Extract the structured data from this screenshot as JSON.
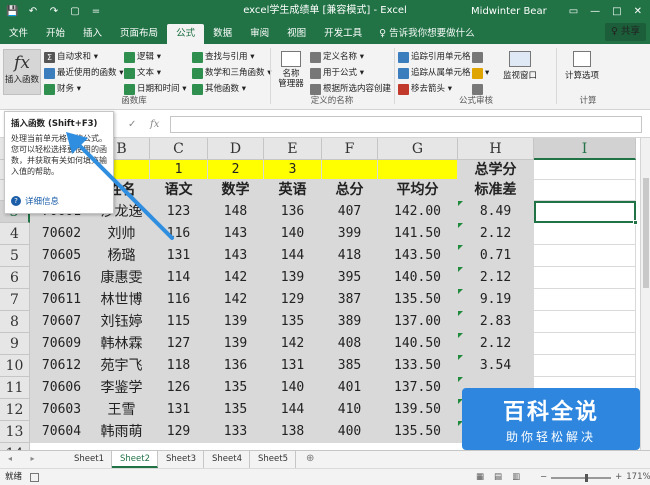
{
  "window": {
    "title": "excel学生成绩单 [兼容模式] - Excel",
    "user": "Midwinter Bear",
    "controls": [
      "▭",
      "—",
      "□",
      "✕"
    ]
  },
  "qat": [
    "💾",
    "↶",
    "↷",
    "▢",
    "="
  ],
  "tabs": [
    {
      "label": "文件",
      "active": false
    },
    {
      "label": "开始",
      "active": false
    },
    {
      "label": "插入",
      "active": false
    },
    {
      "label": "页面布局",
      "active": false
    },
    {
      "label": "公式",
      "active": true
    },
    {
      "label": "数据",
      "active": false
    },
    {
      "label": "审阅",
      "active": false
    },
    {
      "label": "视图",
      "active": false
    },
    {
      "label": "开发工具",
      "active": false
    }
  ],
  "tellme": "♀ 告诉我你想要做什么",
  "share": "♀ 共享",
  "ribbon": {
    "insert_function": {
      "glyph": "fx",
      "label": "插入函数"
    },
    "library": {
      "col1": [
        "自动求和 ▾",
        "最近使用的函数 ▾",
        "财务 ▾"
      ],
      "col2": [
        "逻辑 ▾",
        "文本 ▾",
        "日期和时间 ▾"
      ],
      "col3": [
        "查找与引用 ▾",
        "数学和三角函数 ▾",
        "其他函数 ▾"
      ],
      "group_label": "函数库"
    },
    "defined_names": {
      "name_manager": "名称\n管理器",
      "items": [
        "定义名称 ▾",
        "用于公式 ▾",
        "根据所选内容创建"
      ],
      "group_label": "定义的名称"
    },
    "auditing": {
      "col1": [
        "追踪引用单元格",
        "追踪从属单元格",
        "移去箭头 ▾"
      ],
      "col2": [
        "",
        "▾",
        ""
      ],
      "watch": "监视窗口",
      "group_label": "公式审核"
    },
    "calc": {
      "options": "计算选项",
      "group_label": "计算"
    }
  },
  "tooltip": {
    "title": "插入函数 (Shift+F3)",
    "desc": "处理当前单元格中的公式。您可以轻松选择要使用的函数，并获取有关如何填充输入值的帮助。",
    "more": "详细信息"
  },
  "formula_bar": {
    "controls": [
      "▾",
      "✕",
      "✓",
      "fx"
    ],
    "value": ""
  },
  "columns": [
    {
      "label": "A",
      "w": 0
    },
    {
      "label": "B",
      "w": 0
    },
    {
      "label": "C",
      "w": 0
    },
    {
      "label": "D",
      "w": 0
    },
    {
      "label": "E",
      "w": 0
    },
    {
      "label": "F",
      "w": 0
    },
    {
      "label": "G",
      "w": 0
    },
    {
      "label": "H",
      "w": 0
    },
    {
      "label": "I",
      "w": 0
    }
  ],
  "rows": [
    "1",
    "2",
    "3",
    "4",
    "5",
    "6",
    "7",
    "8",
    "9",
    "10",
    "11",
    "12",
    "13",
    "14"
  ],
  "selected_col": "I",
  "selected_row": "3",
  "header_row1": {
    "C": "1",
    "D": "2",
    "E": "3",
    "H": "总学分"
  },
  "header_row2": [
    "姓名",
    "语文",
    "数学",
    "英语",
    "总分",
    "平均分",
    "标准差"
  ],
  "students": [
    {
      "id": "70601",
      "name": "沙龙逸",
      "chinese": "123",
      "math": "148",
      "english": "136",
      "total": "407",
      "avg": "142.00",
      "sd": "8.49"
    },
    {
      "id": "70602",
      "name": "刘帅",
      "chinese": "116",
      "math": "143",
      "english": "140",
      "total": "399",
      "avg": "141.50",
      "sd": "2.12"
    },
    {
      "id": "70605",
      "name": "杨璐",
      "chinese": "131",
      "math": "143",
      "english": "144",
      "total": "418",
      "avg": "143.50",
      "sd": "0.71"
    },
    {
      "id": "70616",
      "name": "康惠雯",
      "chinese": "114",
      "math": "142",
      "english": "139",
      "total": "395",
      "avg": "140.50",
      "sd": "2.12"
    },
    {
      "id": "70611",
      "name": "林世博",
      "chinese": "116",
      "math": "142",
      "english": "129",
      "total": "387",
      "avg": "135.50",
      "sd": "9.19"
    },
    {
      "id": "70607",
      "name": "刘钰婷",
      "chinese": "115",
      "math": "139",
      "english": "135",
      "total": "389",
      "avg": "137.00",
      "sd": "2.83"
    },
    {
      "id": "70609",
      "name": "韩林霖",
      "chinese": "127",
      "math": "139",
      "english": "142",
      "total": "408",
      "avg": "140.50",
      "sd": "2.12"
    },
    {
      "id": "70612",
      "name": "苑宇飞",
      "chinese": "118",
      "math": "136",
      "english": "131",
      "total": "385",
      "avg": "133.50",
      "sd": "3.54"
    },
    {
      "id": "70606",
      "name": "李鉴学",
      "chinese": "126",
      "math": "135",
      "english": "140",
      "total": "401",
      "avg": "137.50",
      "sd": ""
    },
    {
      "id": "70603",
      "name": "王雪",
      "chinese": "131",
      "math": "135",
      "english": "144",
      "total": "410",
      "avg": "139.50",
      "sd": ""
    },
    {
      "id": "70604",
      "name": "韩雨萌",
      "chinese": "129",
      "math": "133",
      "english": "138",
      "total": "400",
      "avg": "135.50",
      "sd": ""
    }
  ],
  "sheets": [
    {
      "label": "Sheet1",
      "active": false
    },
    {
      "label": "Sheet2",
      "active": true
    },
    {
      "label": "Sheet3",
      "active": false
    },
    {
      "label": "Sheet4",
      "active": false
    },
    {
      "label": "Sheet5",
      "active": false
    }
  ],
  "sheet_nav": "◂ ▸",
  "add_sheet": "⊕",
  "status": {
    "ready": "就绪",
    "views": [
      "▦",
      "▤",
      "▥"
    ],
    "zoom": "171%",
    "zoom_minus": "−",
    "zoom_plus": "+"
  },
  "watermark": {
    "line1": "百科全说",
    "line2": "助你轻松解决"
  },
  "colors": {
    "excel_green": "#217346",
    "header_yellow": "#ffff00",
    "cell_gray": "#d9d9d9",
    "watermark_blue": "#2e86de"
  }
}
